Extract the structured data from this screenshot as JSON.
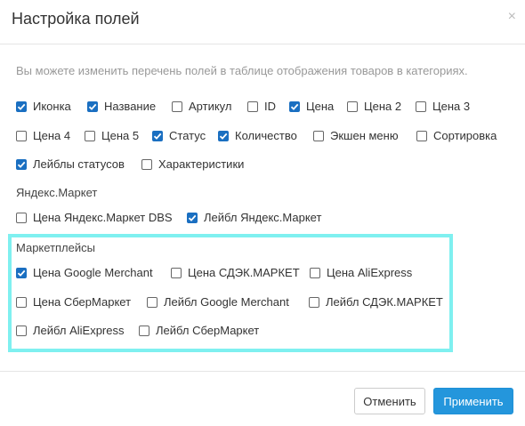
{
  "dialog": {
    "title": "Настройка полей",
    "close_symbol": "×",
    "hint": "Вы можете изменить перечень полей в таблице отображения товаров в категориях."
  },
  "fields": [
    {
      "label": "Иконка",
      "checked": true
    },
    {
      "label": "Название",
      "checked": true
    },
    {
      "label": "Артикул",
      "checked": false
    },
    {
      "label": "ID",
      "checked": false
    },
    {
      "label": "Цена",
      "checked": true
    },
    {
      "label": "Цена 2",
      "checked": false
    },
    {
      "label": "Цена 3",
      "checked": false
    },
    {
      "label": "Цена 4",
      "checked": false
    },
    {
      "label": "Цена 5",
      "checked": false
    },
    {
      "label": "Статус",
      "checked": true
    },
    {
      "label": "Количество",
      "checked": true
    },
    {
      "label": "Экшен меню",
      "checked": false
    },
    {
      "label": "Сортировка",
      "checked": false
    },
    {
      "label": "Лейблы статусов",
      "checked": true
    },
    {
      "label": "Характеристики",
      "checked": false
    }
  ],
  "yandex": {
    "title": "Яндекс.Маркет",
    "items": [
      {
        "label": "Цена Яндекс.Маркет DBS",
        "checked": false
      },
      {
        "label": "Лейбл Яндекс.Маркет",
        "checked": true
      }
    ]
  },
  "marketplaces": {
    "title": "Маркетплейсы",
    "items": [
      {
        "label": "Цена Google Merchant",
        "checked": true
      },
      {
        "label": "Цена СДЭК.МАРКЕТ",
        "checked": false
      },
      {
        "label": "Цена AliExpress",
        "checked": false
      },
      {
        "label": "Цена СберМаркет",
        "checked": false
      },
      {
        "label": "Лейбл Google Merchant",
        "checked": false
      },
      {
        "label": "Лейбл СДЭК.МАРКЕТ",
        "checked": false
      },
      {
        "label": "Лейбл AliExpress",
        "checked": false
      },
      {
        "label": "Лейбл СберМаркет",
        "checked": false
      }
    ]
  },
  "footer": {
    "cancel": "Отменить",
    "apply": "Применить"
  },
  "colors": {
    "accent": "#1a6fc1",
    "apply_button": "#2496dc",
    "highlight": "#7ff0f0"
  }
}
